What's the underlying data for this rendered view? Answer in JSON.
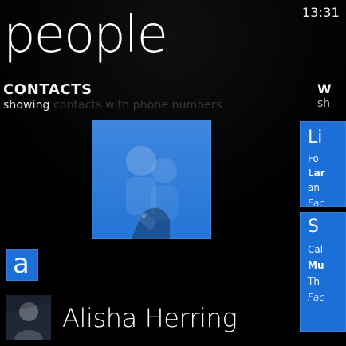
{
  "status": {
    "time": "13:31"
  },
  "app": {
    "title": "people"
  },
  "section": {
    "title": "CONTACTS",
    "subtitle_prefix": "showing",
    "subtitle_suffix": "contacts with phone numbers"
  },
  "right_peek": {
    "header": "W",
    "subheader": "sh",
    "card1": {
      "big": "Li",
      "l1": "Fo",
      "l2": "Lar",
      "l3": "an",
      "l4": "Fac"
    },
    "card2": {
      "big": "S",
      "l1": "Cal",
      "l2": "Mu",
      "l3": "Th",
      "l4": "Fac"
    }
  },
  "groups": {
    "current_letter": "a"
  },
  "contacts": [
    {
      "name": "Alisha Herring"
    }
  ],
  "icons": {
    "hero_tile": "people-hub-icon",
    "contact_avatar": "contact-photo"
  },
  "colors": {
    "accent": "#1b6fd6",
    "background": "#000000",
    "text": "#ffffff"
  }
}
